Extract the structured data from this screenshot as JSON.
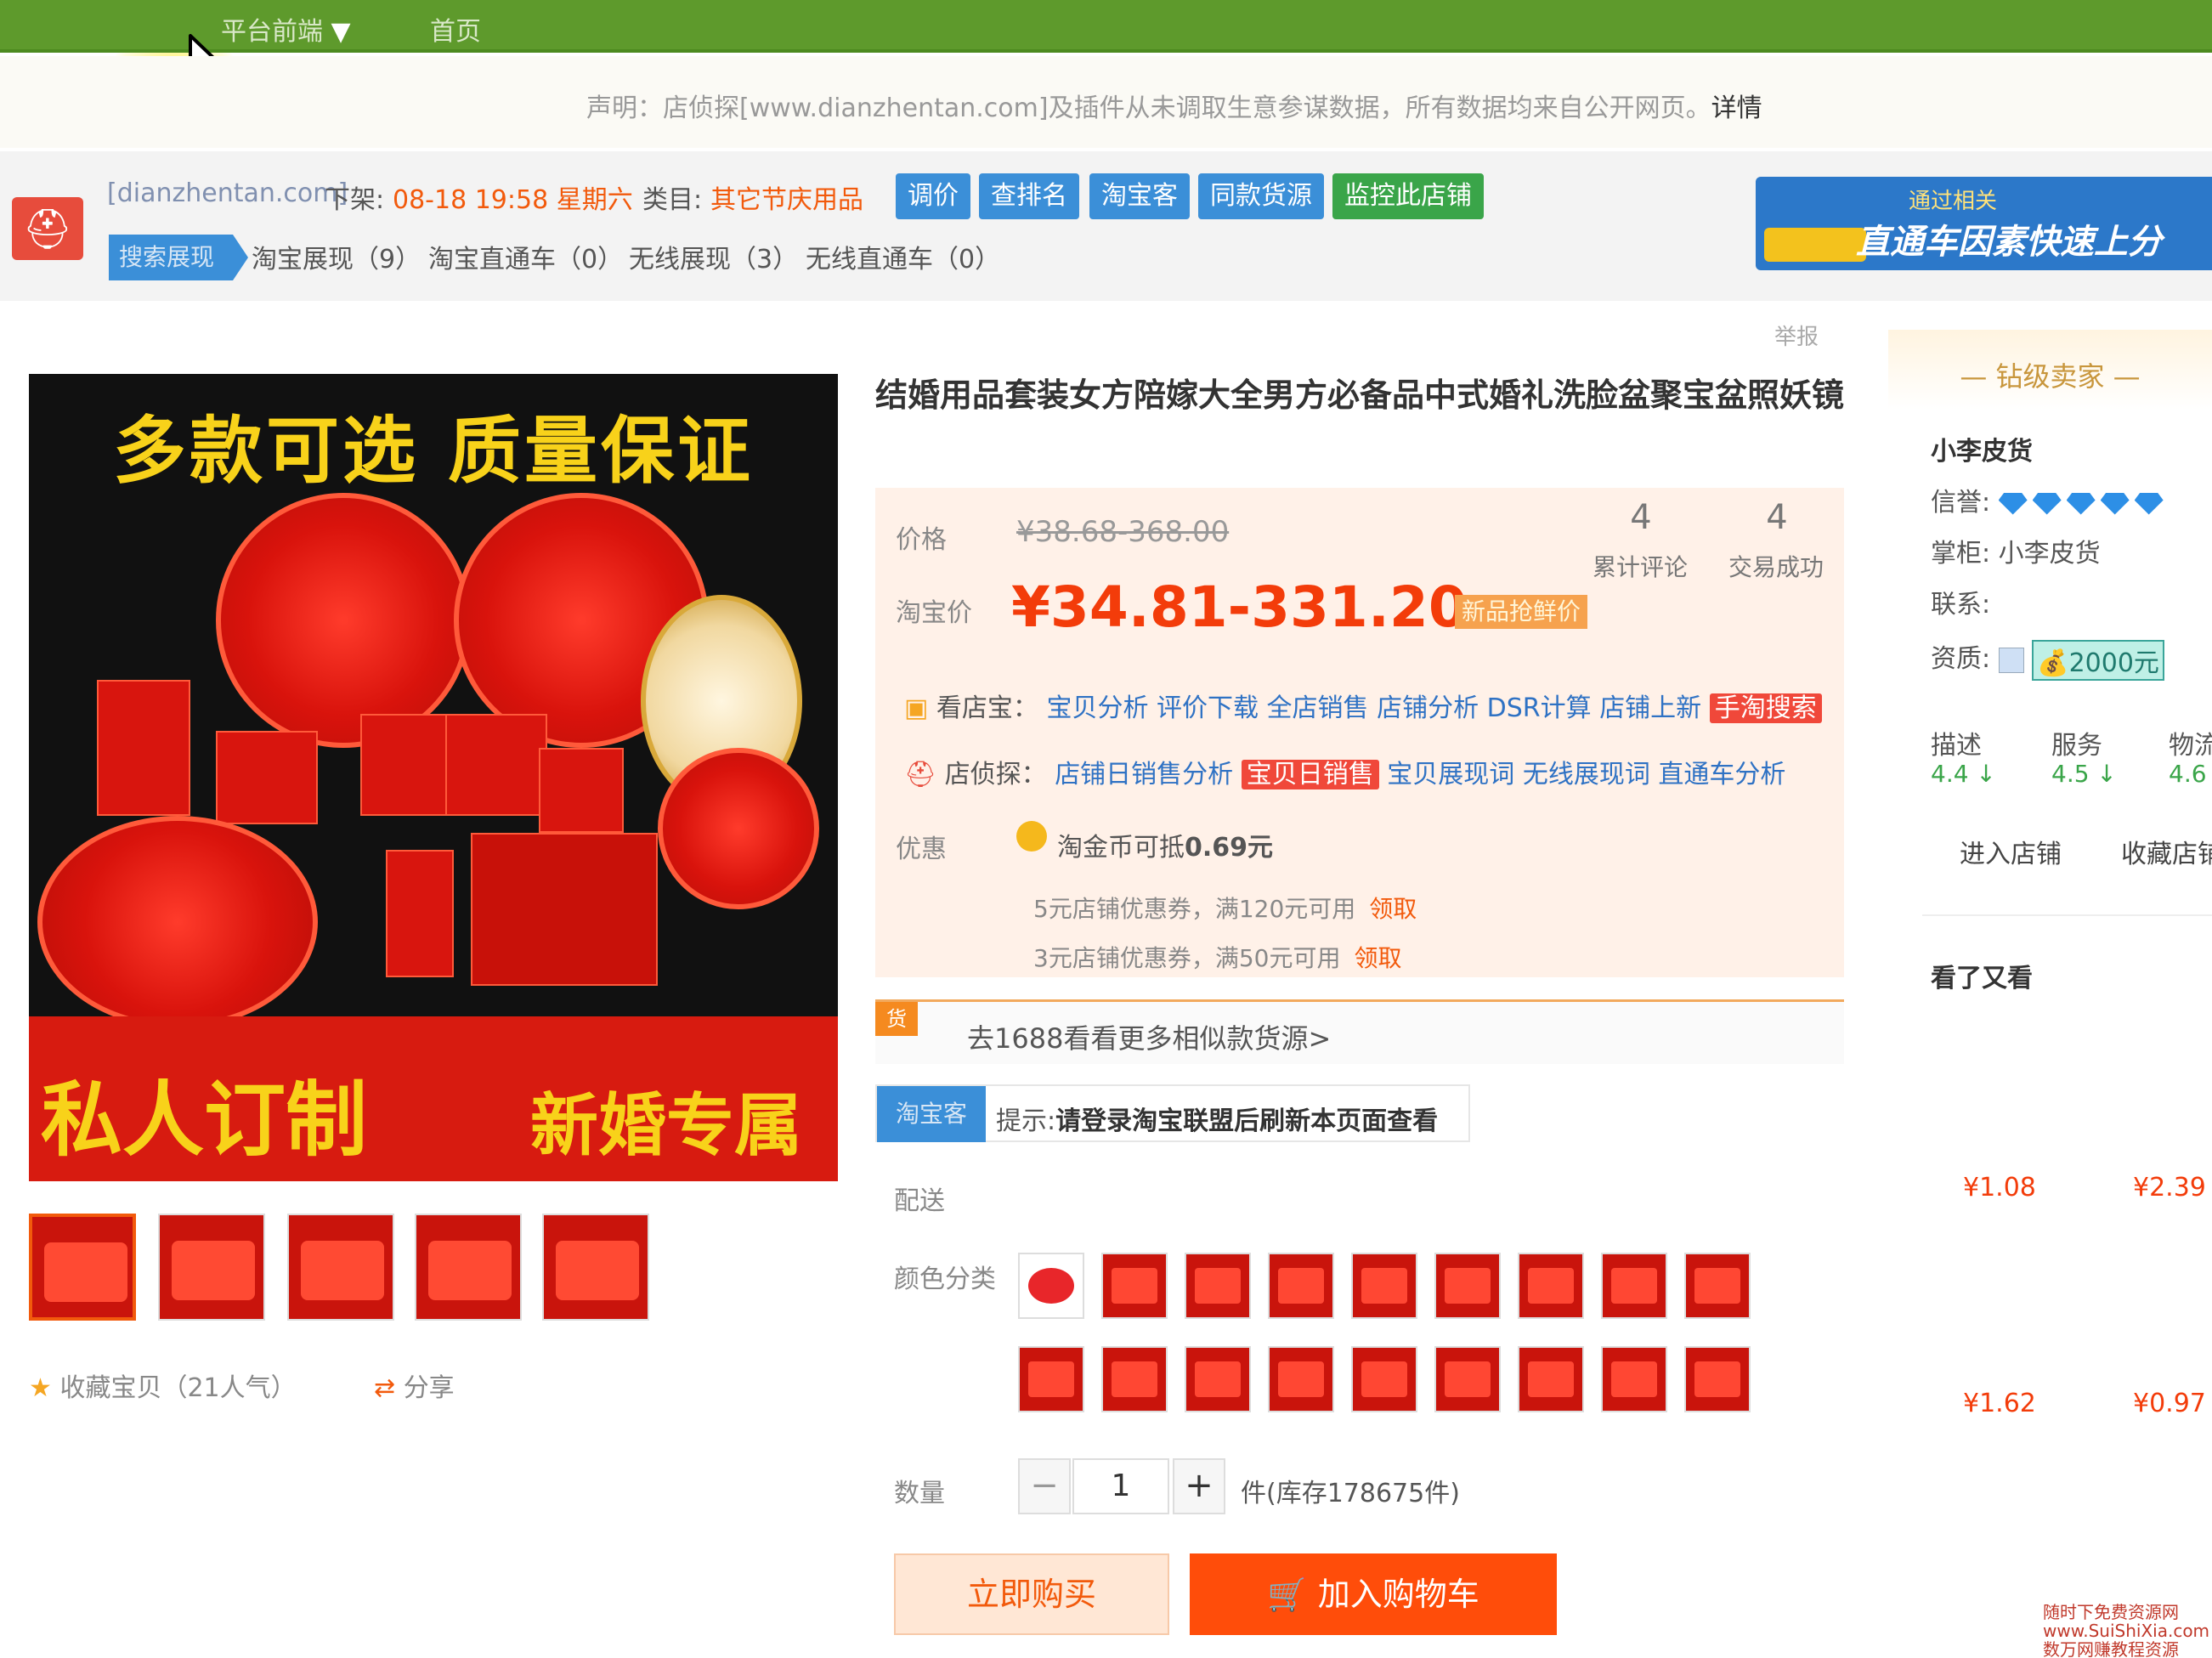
{
  "top_nav": {
    "category": "平台前端",
    "home": "首页"
  },
  "notice": {
    "text": "声明：店侦探[www.dianzhentan.com]及插件从未调取生意参谋数据，所有数据均来自公开网页。",
    "detail": "详情"
  },
  "plugin": {
    "site": "[dianzhentan.com]",
    "offline_label": "下架:",
    "offline_time": "08-18 19:58 星期六",
    "category_label": "类目:",
    "category": "其它节庆用品",
    "buttons": [
      "调价",
      "查排名",
      "淘宝客",
      "同款货源",
      "监控此店铺"
    ],
    "active_tab": "搜索展现",
    "tabs": [
      "淘宝展现（9）",
      "淘宝直通车（0）",
      "无线展现（3）",
      "无线直通车（0）"
    ],
    "ad": {
      "line1": "通过相关",
      "line2": "直通车因素快速上分"
    }
  },
  "gallery": {
    "main_image": {
      "top_text": "多款可选   质量保证",
      "bottom_left": "私人订制",
      "bottom_right": "新婚专属"
    },
    "favorite": "收藏宝贝（21人气）",
    "share": "分享"
  },
  "product": {
    "title": "结婚用品套装女方陪嫁大全男方必备品中式婚礼洗脸盆聚宝盆照妖镜",
    "report": "举报",
    "price_label": "价格",
    "price_original": "¥38.68-368.00",
    "taobao_price_label": "淘宝价",
    "price_current": "¥34.81-331.20",
    "price_tag": "新品抢鲜价",
    "review_count": "4",
    "review_label": "累计评论",
    "deal_count": "4",
    "deal_label": "交易成功",
    "kandianbao": {
      "name": "看店宝：",
      "links": [
        "宝贝分析",
        "评价下载",
        "全店销售",
        "店铺分析",
        "DSR计算",
        "店铺上新"
      ],
      "highlight": "手淘搜索"
    },
    "dianzhentan": {
      "name": "店侦探：",
      "links_before": [
        "店铺日销售分析"
      ],
      "highlight": "宝贝日销售",
      "links_after": [
        "宝贝展现词",
        "无线展现词",
        "直通车分析"
      ]
    },
    "promo_label": "优惠",
    "coin_text": "淘金币可抵",
    "coin_value": "0.69元",
    "coupons": [
      {
        "text": "5元店铺优惠券，满120元可用",
        "action": "领取"
      },
      {
        "text": "3元店铺优惠券，满50元可用",
        "action": "领取"
      }
    ],
    "source_corner": "货",
    "source_text": "去1688看看更多相似款货源>",
    "tbk_badge": "淘宝客",
    "tbk_hint_label": "提示:",
    "tbk_hint": "请登录淘宝联盟后刷新本页面查看",
    "shipping_label": "配送",
    "color_label": "颜色分类",
    "quantity_label": "数量",
    "quantity_value": "1",
    "stock": "件(库存178675件)",
    "minus": "−",
    "plus": "+",
    "buy_now": "立即购买",
    "add_cart": "加入购物车"
  },
  "sidebar": {
    "header": "钻级卖家",
    "shop_name": "小李皮货",
    "credit_label": "信誉:",
    "keeper_label": "掌柜:",
    "keeper": "小李皮货",
    "contact_label": "联系:",
    "qual_label": "资质:",
    "deposit": "2000元",
    "scores": [
      {
        "label": "描述",
        "value": "4.4 ↓"
      },
      {
        "label": "服务",
        "value": "4.5 ↓"
      },
      {
        "label": "物流",
        "value": "4.6"
      }
    ],
    "enter_shop": "进入店铺",
    "fav_shop": "收藏店铺",
    "also_viewed": "看了又看",
    "prices": [
      "¥1.08",
      "¥2.39",
      "¥1.62",
      "¥0.97"
    ]
  },
  "watermark": {
    "line1": "随时下免费资源网",
    "line2": "www.SuiShiXia.com",
    "line3": "数万网赚教程资源"
  }
}
